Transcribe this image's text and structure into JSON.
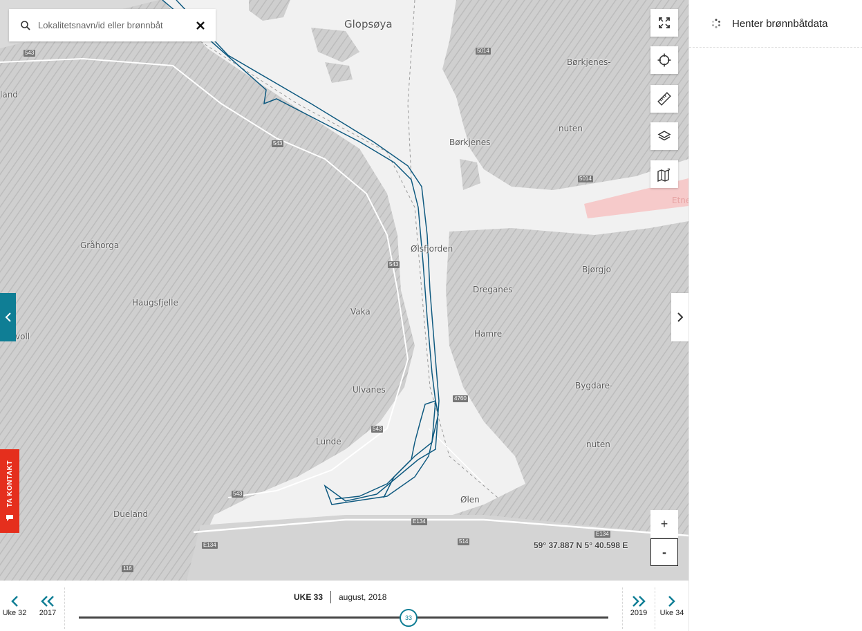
{
  "search": {
    "placeholder": "Lokalitetsnavn/id eller brønnbåt"
  },
  "map": {
    "places": [
      {
        "name": "Glopsøya",
        "big": true
      },
      {
        "name": "Børkjenes-"
      },
      {
        "name": "nuten"
      },
      {
        "name": "Børkjenes"
      },
      {
        "name": "Etne"
      },
      {
        "name": "Ølsfjorden"
      },
      {
        "name": "Gråhorga"
      },
      {
        "name": "Haugsfjelle"
      },
      {
        "name": "Vaka"
      },
      {
        "name": "Dreganes"
      },
      {
        "name": "Bjørgjo"
      },
      {
        "name": "Hamre"
      },
      {
        "name": "Bygdare-"
      },
      {
        "name": "nuten"
      },
      {
        "name": "Ulvanes"
      },
      {
        "name": "Lunde"
      },
      {
        "name": "Ølen"
      },
      {
        "name": "Dueland"
      },
      {
        "name": "land"
      },
      {
        "name": "voll"
      }
    ],
    "roads": [
      "543",
      "543",
      "543",
      "543",
      "543",
      "5014",
      "5014",
      "4760",
      "E134",
      "E134",
      "E134",
      "514",
      "116"
    ],
    "coordinates": "59° 37.887 N 5° 40.598 E"
  },
  "tools": {
    "fullscreen": "fullscreen-icon",
    "locate": "crosshair-icon",
    "measure": "ruler-icon",
    "layers": "layers-icon",
    "legend": "map-help-icon",
    "zoom_in": "+",
    "zoom_out": "-"
  },
  "contact": {
    "label": "TA KONTAKT"
  },
  "panel": {
    "status": "Henter brønnbåtdata"
  },
  "timebar": {
    "prev_week": "Uke 32",
    "prev_year": "2017",
    "week": "UKE 33",
    "month": "august, 2018",
    "current_week_number": "33",
    "next_year": "2019",
    "next_week": "Uke 34"
  },
  "colors": {
    "accent": "#0f7e95",
    "track": "#0f5a80",
    "contact": "#e52f1d"
  }
}
